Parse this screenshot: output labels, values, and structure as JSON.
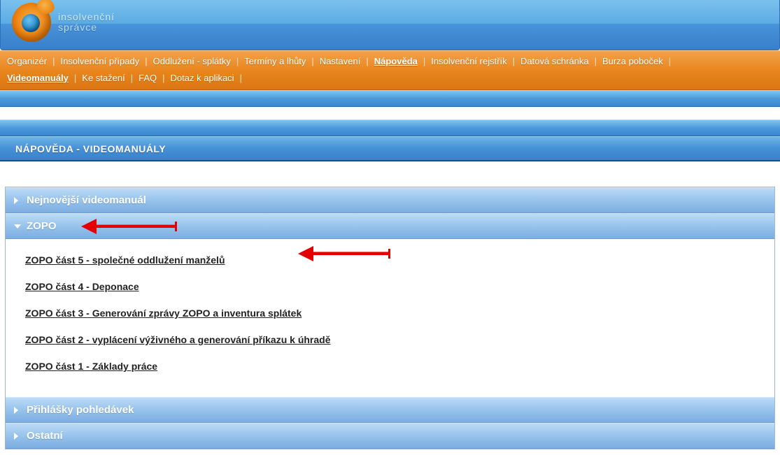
{
  "logo": {
    "line1": "insolvenční",
    "line2": "správce"
  },
  "nav": {
    "row1": [
      "Organizér",
      "Insolvenční případy",
      "Oddlužení - splátky",
      "Termíny a lhůty",
      "Nastavení",
      "Nápověda",
      "Insolvenční rejstřík",
      "Datová schránka",
      "Burza poboček"
    ],
    "row1_active_index": 5,
    "row2": [
      "Videomanuály",
      "Ke stažení",
      "FAQ",
      "Dotaz k aplikaci"
    ],
    "row2_active_index": 0
  },
  "page_title": "NÁPOVĚDA - VIDEOMANUÁLY",
  "accordion": {
    "sections": [
      {
        "title": "Nejnovější videomanuál",
        "expanded": false
      },
      {
        "title": "ZOPO",
        "expanded": true,
        "items": [
          "ZOPO část 5 - společné oddlužení manželů",
          "ZOPO část 4 - Deponace",
          "ZOPO část 3 - Generování zprávy ZOPO a inventura splátek",
          "ZOPO část 2 - vyplácení výživného a generování příkazu k úhradě",
          "ZOPO část 1 - Základy práce"
        ]
      },
      {
        "title": "Přihlášky pohledávek",
        "expanded": false
      },
      {
        "title": "Ostatní",
        "expanded": false
      }
    ]
  }
}
